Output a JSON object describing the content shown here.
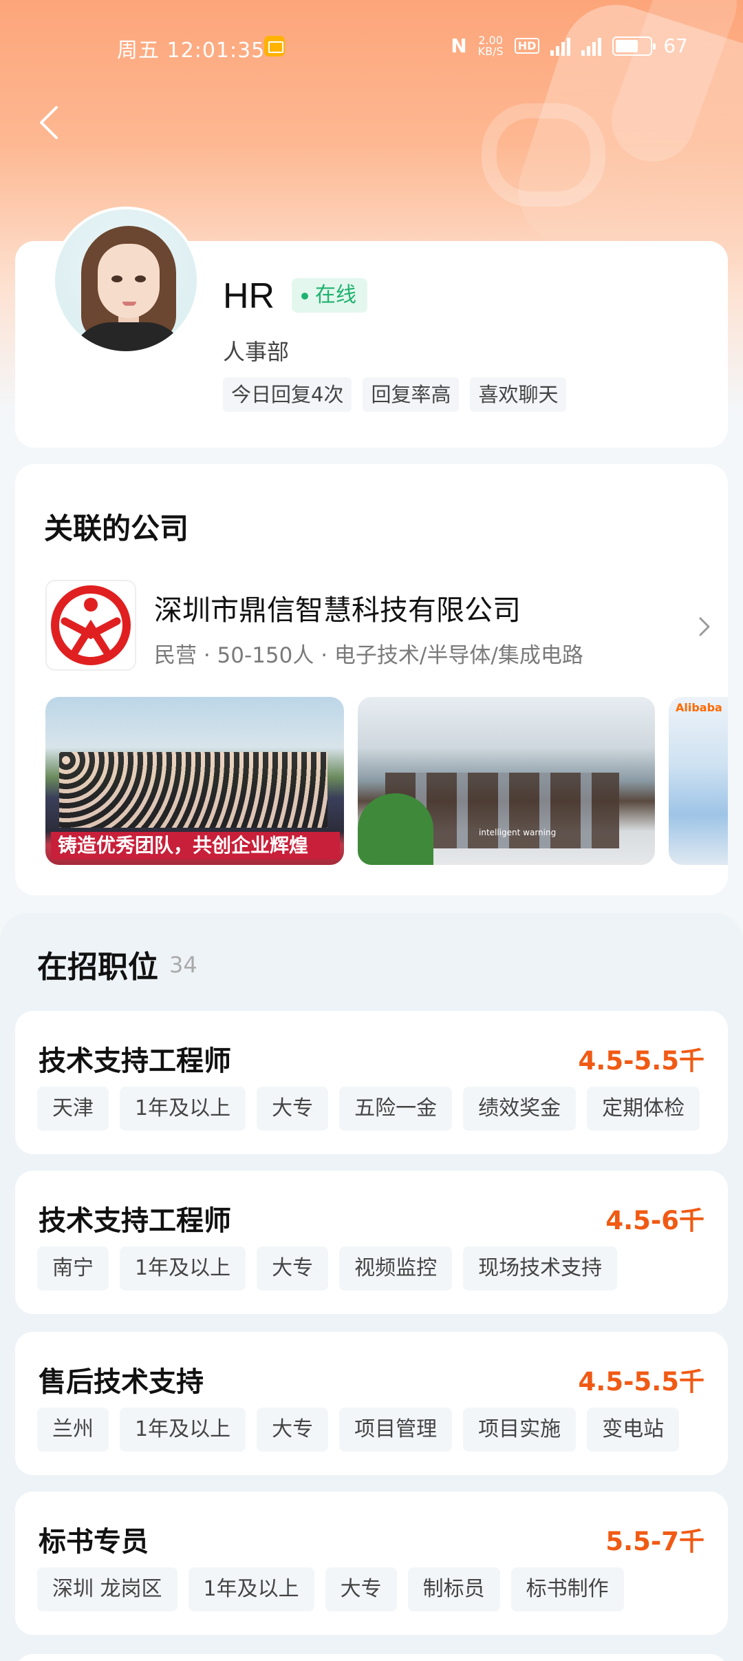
{
  "status_bar": {
    "time": "周五 12:01:35",
    "net_speed_top": "2.00",
    "net_speed_bottom": "KB/S",
    "hd": "HD",
    "sig1": "4G",
    "sig2": "4G",
    "battery": "67"
  },
  "hr": {
    "name": "HR",
    "status": "在线",
    "department": "人事部",
    "tags": [
      "今日回复4次",
      "回复率高",
      "喜欢聊天"
    ]
  },
  "company": {
    "section_title": "关联的公司",
    "name": "深圳市鼎信智慧科技有限公司",
    "meta": "民营 · 50-150人 · 电子技术/半导体/集成电路",
    "photo1_banner": "铸造优秀团队，共创企业辉煌",
    "photo2_caption": "intelligent warning",
    "photo3_brand": "Alibaba"
  },
  "jobs": {
    "section_title": "在招职位",
    "count": "34",
    "items": [
      {
        "title": "技术支持工程师",
        "salary": "4.5-5.5千",
        "tags": [
          "天津",
          "1年及以上",
          "大专",
          "五险一金",
          "绩效奖金",
          "定期体检"
        ]
      },
      {
        "title": "技术支持工程师",
        "salary": "4.5-6千",
        "tags": [
          "南宁",
          "1年及以上",
          "大专",
          "视频监控",
          "现场技术支持"
        ]
      },
      {
        "title": "售后技术支持",
        "salary": "4.5-5.5千",
        "tags": [
          "兰州",
          "1年及以上",
          "大专",
          "项目管理",
          "项目实施",
          "变电站"
        ]
      },
      {
        "title": "标书专员",
        "salary": "5.5-7千",
        "tags": [
          "深圳  龙岗区",
          "1年及以上",
          "大专",
          "制标员",
          "标书制作"
        ]
      }
    ]
  },
  "colors": {
    "accent_orange": "#f05a14",
    "online_green": "#1fb26e",
    "logo_red": "#e02020"
  }
}
